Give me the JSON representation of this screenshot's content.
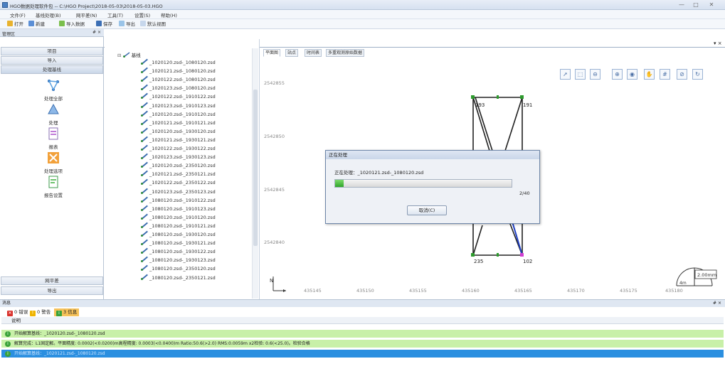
{
  "window": {
    "title": "HGO数据处理软件包 -- C:\\HGO Project\\2018-05-03\\2018-05-03.HGO",
    "min": "—",
    "max": "□",
    "close": "✕"
  },
  "menu": [
    "文件(F)",
    "基线处理(B)",
    "网平差(N)",
    "工具(T)",
    "设置(S)",
    "帮助(H)"
  ],
  "toolbar": [
    "打开",
    "新建",
    "导入数据",
    "保存",
    "导出",
    "默认视图"
  ],
  "left_panel": {
    "title": "管理区",
    "pin": "# ×",
    "nav_top": [
      "项目",
      "导入",
      "处理基线"
    ],
    "items": [
      "处理全部",
      "处理",
      "报表",
      "处理选项",
      "报告设置"
    ],
    "nav_bottom": [
      "网平差",
      "导出"
    ]
  },
  "doc_tab": "2018-05-03",
  "doc_close": "▾ ×",
  "tree": {
    "root": "基线",
    "rows": [
      "_1020120.zsd-_1080120.zsd",
      "_1020121.zsd-_1080120.zsd",
      "_1020122.zsd-_1080120.zsd",
      "_1020123.zsd-_1080120.zsd",
      "_1020122.zsd-_1910122.zsd",
      "_1020123.zsd-_1910123.zsd",
      "_1020120.zsd-_1910120.zsd",
      "_1020121.zsd-_1910121.zsd",
      "_1020120.zsd-_1930120.zsd",
      "_1020121.zsd-_1930121.zsd",
      "_1020122.zsd-_1930122.zsd",
      "_1020123.zsd-_1930123.zsd",
      "_1020120.zsd-_2350120.zsd",
      "_1020121.zsd-_2350121.zsd",
      "_1020122.zsd-_2350122.zsd",
      "_1020123.zsd-_2350123.zsd",
      "_1080120.zsd-_1910122.zsd",
      "_1080120.zsd-_1910123.zsd",
      "_1080120.zsd-_1910120.zsd",
      "_1080120.zsd-_1910121.zsd",
      "_1080120.zsd-_1930120.zsd",
      "_1080120.zsd-_1930121.zsd",
      "_1080120.zsd-_1930122.zsd",
      "_1080120.zsd-_1930123.zsd",
      "_1080120.zsd-_2350120.zsd",
      "_1080120.zsd-_2350121.zsd"
    ]
  },
  "chart_tabs": [
    "平面图",
    "站点",
    "时间表",
    "多重观测原始数据"
  ],
  "chart": {
    "y_ticks": [
      "2542855",
      "2542850",
      "2542845",
      "2542840"
    ],
    "x_ticks": [
      "435145",
      "435150",
      "435155",
      "435160",
      "435165",
      "435170",
      "435175",
      "435180"
    ],
    "station_labels": [
      "193",
      "191",
      "235",
      "102"
    ],
    "scale_label": "2.00mm",
    "scale_sub": "4m",
    "north": "N",
    "tool_icons": [
      "pointer-icon",
      "zoom-box-icon",
      "zoom-out-icon",
      "zoom-in-icon",
      "globe-icon",
      "pan-icon",
      "grid-icon",
      "no-entry-icon",
      "refresh-icon"
    ],
    "colors": {
      "line": "#222222",
      "blue_line": "#1f3fc2",
      "station": "#2d9b2d",
      "magenta": "#d23fd2"
    }
  },
  "dialog": {
    "title": "正在处理",
    "message": "正在处理：_1020121.zsd-_1080120.zsd",
    "count": "2/40",
    "progress": 0.05,
    "cancel": "取消(C)"
  },
  "bottom": {
    "title": "消息",
    "pin": "# ×",
    "filters": [
      {
        "count": "0",
        "label": "错误",
        "color": "#d9302b"
      },
      {
        "count": "0",
        "label": "警告",
        "color": "#f0b400"
      },
      {
        "count": "3",
        "label": "信息",
        "color": "#3aa23a"
      }
    ],
    "column": "说明",
    "log": [
      "开始解算基线：_1020120.zsd-_1080120.zsd",
      "解算完成：L1固定解。平面精度: 0.0002(<0.0200)m高程精度: 0.0003(<0.0400)m Ratio:50.6(>2.0) RMS:0.0059m x2检验: 0.6(<25.0)。检验合格",
      "开始解算基线：_1020121.zsd-_1080120.zsd"
    ]
  }
}
